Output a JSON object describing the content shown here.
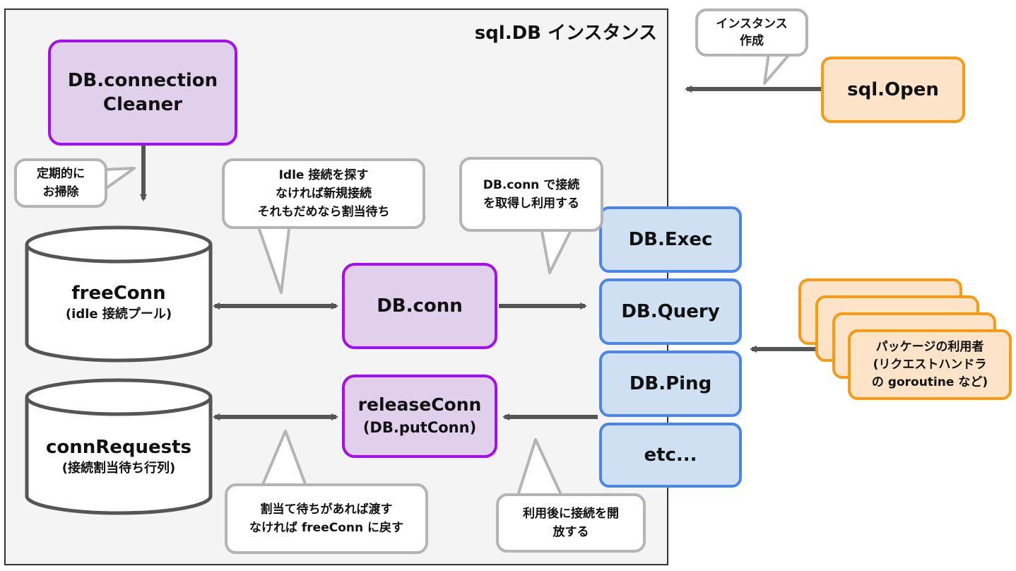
{
  "frame": {
    "title": "sql.DB インスタンス"
  },
  "cleaner": {
    "line1": "DB.connection",
    "line2": "Cleaner"
  },
  "free_conn": {
    "title": "freeConn",
    "subtitle": "(idle 接続プール)"
  },
  "conn_requests": {
    "title": "connRequests",
    "subtitle": "(接続割当待ち行列)"
  },
  "db_conn": {
    "label": "DB.conn"
  },
  "release_conn": {
    "line1": "releaseConn",
    "line2": "(DB.putConn)"
  },
  "methods": [
    {
      "label": "DB.Exec"
    },
    {
      "label": "DB.Query"
    },
    {
      "label": "DB.Ping"
    },
    {
      "label": "etc..."
    }
  ],
  "sql_open": {
    "label": "sql.Open"
  },
  "users": {
    "line1": "パッケージの利用者",
    "line2": "(リクエストハンドラ",
    "line3": "の goroutine など)"
  },
  "callouts": {
    "instance_create": {
      "line1": "インスタンス",
      "line2": "作成"
    },
    "cleanup": {
      "line1": "定期的に",
      "line2": "お掃除"
    },
    "find_idle": {
      "line1": "Idle 接続を探す",
      "line2": "なければ新規接続",
      "line3": "それもだめなら割当待ち"
    },
    "get_conn": {
      "line1": "DB.conn で接続",
      "line2": "を取得し利用する"
    },
    "hand_over": {
      "line1": "割当て待ちがあれば渡す",
      "line2": "なければ freeConn に戻す"
    },
    "release_after": {
      "line1": "利用後に接続を開",
      "line2": "放する"
    }
  },
  "colors": {
    "purple_fill": "#e1d0ec",
    "purple_border": "#a50ff0",
    "blue_fill": "#cfe0f3",
    "blue_border": "#4b86e6",
    "orange_fill": "#fde3c8",
    "orange_border": "#f79a14",
    "arrow": "#555555",
    "callout_border": "#b4b4b4"
  }
}
